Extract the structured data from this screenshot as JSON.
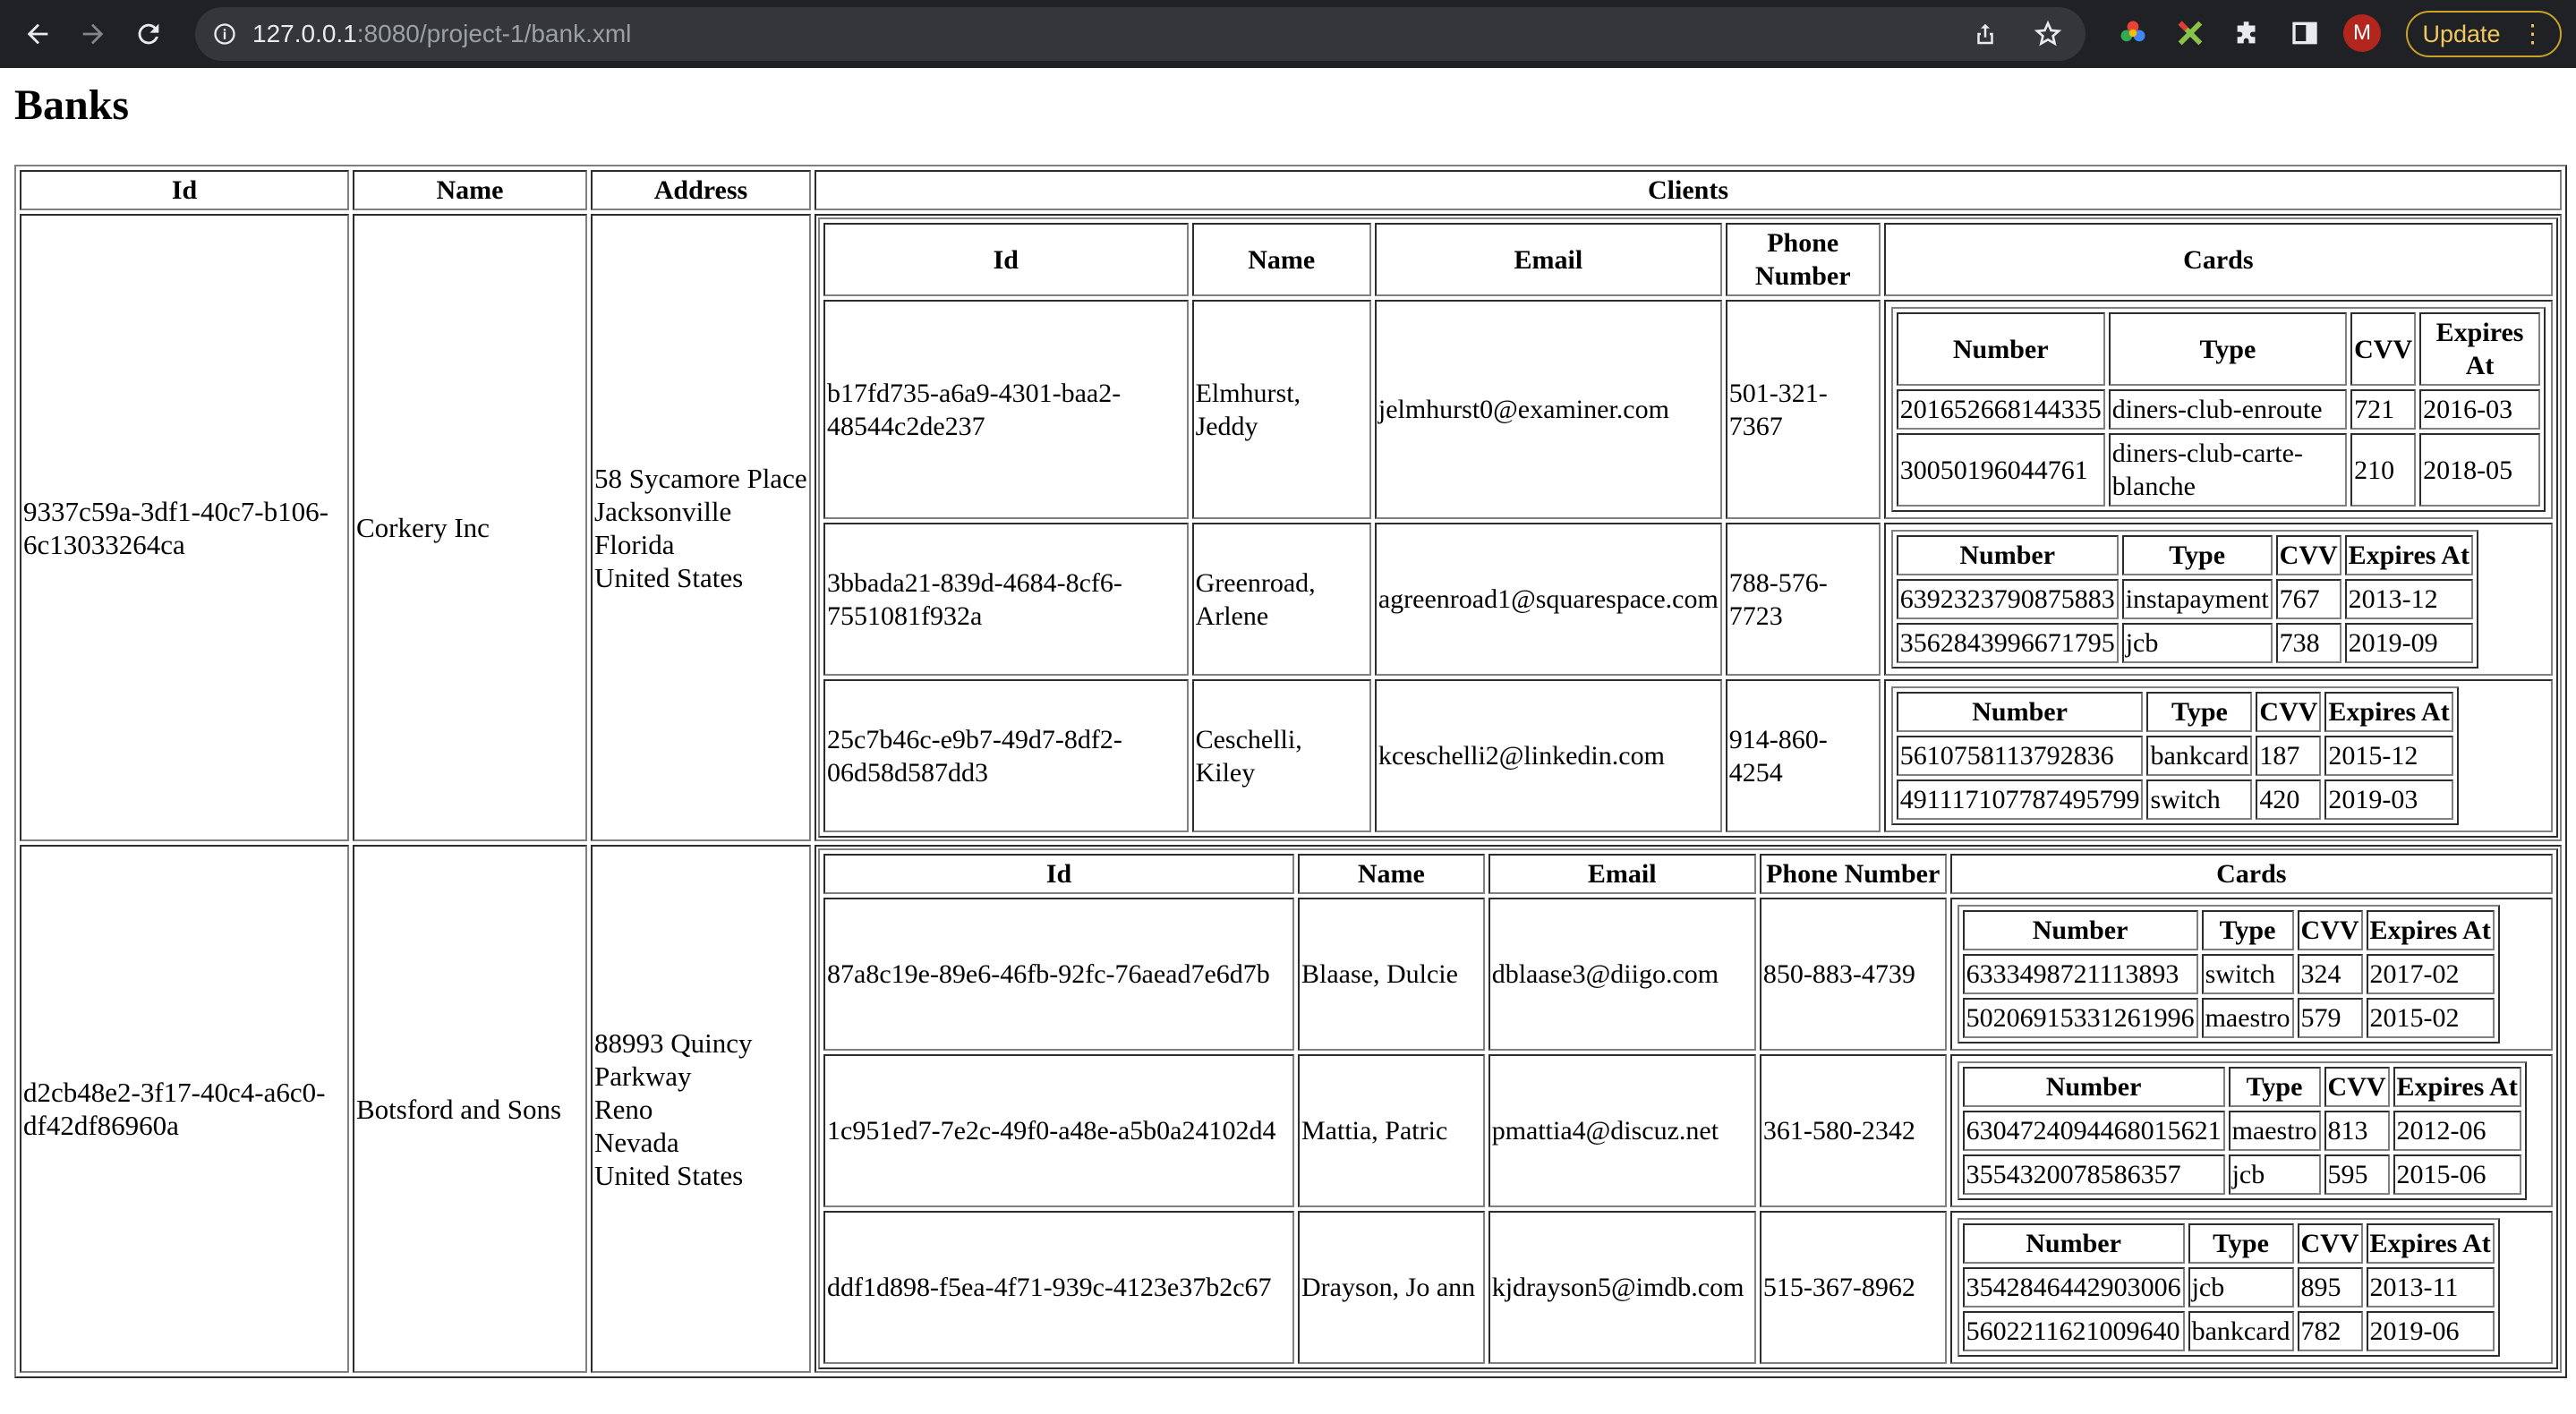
{
  "browser": {
    "url_host": "127.0.0.1",
    "url_rest": ":8080/project-1/bank.xml",
    "avatar_letter": "M",
    "update_label": "Update"
  },
  "page": {
    "title": "Banks",
    "headers": [
      "Id",
      "Name",
      "Address",
      "Clients"
    ],
    "client_headers": [
      "Id",
      "Name",
      "Email",
      "Phone Number",
      "Cards"
    ],
    "card_headers": [
      "Number",
      "Type",
      "CVV",
      "Expires At"
    ]
  },
  "banks": [
    {
      "id": "9337c59a-3df1-40c7-b106-6c13033264ca",
      "name": "Corkery Inc",
      "address": [
        "58 Sycamore Place",
        "Jacksonville",
        "Florida",
        "United States"
      ],
      "clients": [
        {
          "id": "b17fd735-a6a9-4301-baa2-48544c2de237",
          "name": "Elmhurst, Jeddy",
          "email": "jelmhurst0@examiner.com",
          "phone": "501-321-7367",
          "cards": [
            {
              "number": "201652668144335",
              "type": "diners-club-enroute",
              "cvv": "721",
              "expires": "2016-03"
            },
            {
              "number": "30050196044761",
              "type": "diners-club-carte-blanche",
              "cvv": "210",
              "expires": "2018-05"
            }
          ]
        },
        {
          "id": "3bbada21-839d-4684-8cf6-7551081f932a",
          "name": "Greenroad, Arlene",
          "email": "agreenroad1@squarespace.com",
          "phone": "788-576-7723",
          "cards": [
            {
              "number": "6392323790875883",
              "type": "instapayment",
              "cvv": "767",
              "expires": "2013-12"
            },
            {
              "number": "3562843996671795",
              "type": "jcb",
              "cvv": "738",
              "expires": "2019-09"
            }
          ]
        },
        {
          "id": "25c7b46c-e9b7-49d7-8df2-06d58d587dd3",
          "name": "Ceschelli, Kiley",
          "email": "kceschelli2@linkedin.com",
          "phone": "914-860-4254",
          "cards": [
            {
              "number": "5610758113792836",
              "type": "bankcard",
              "cvv": "187",
              "expires": "2015-12"
            },
            {
              "number": "491117107787495799",
              "type": "switch",
              "cvv": "420",
              "expires": "2019-03"
            }
          ]
        }
      ]
    },
    {
      "id": "d2cb48e2-3f17-40c4-a6c0-df42df86960a",
      "name": "Botsford and Sons",
      "address": [
        "88993 Quincy Parkway",
        "Reno",
        "Nevada",
        "United States"
      ],
      "clients": [
        {
          "id": "87a8c19e-89e6-46fb-92fc-76aead7e6d7b",
          "name": "Blaase, Dulcie",
          "email": "dblaase3@diigo.com",
          "phone": "850-883-4739",
          "cards": [
            {
              "number": "6333498721113893",
              "type": "switch",
              "cvv": "324",
              "expires": "2017-02"
            },
            {
              "number": "50206915331261996",
              "type": "maestro",
              "cvv": "579",
              "expires": "2015-02"
            }
          ]
        },
        {
          "id": "1c951ed7-7e2c-49f0-a48e-a5b0a24102d4",
          "name": "Mattia, Patric",
          "email": "pmattia4@discuz.net",
          "phone": "361-580-2342",
          "cards": [
            {
              "number": "6304724094468015621",
              "type": "maestro",
              "cvv": "813",
              "expires": "2012-06"
            },
            {
              "number": "3554320078586357",
              "type": "jcb",
              "cvv": "595",
              "expires": "2015-06"
            }
          ]
        },
        {
          "id": "ddf1d898-f5ea-4f71-939c-4123e37b2c67",
          "name": "Drayson, Jo ann",
          "email": "kjdrayson5@imdb.com",
          "phone": "515-367-8962",
          "cards": [
            {
              "number": "3542846442903006",
              "type": "jcb",
              "cvv": "895",
              "expires": "2013-11"
            },
            {
              "number": "5602211621009640",
              "type": "bankcard",
              "cvv": "782",
              "expires": "2019-06"
            }
          ]
        }
      ]
    }
  ]
}
